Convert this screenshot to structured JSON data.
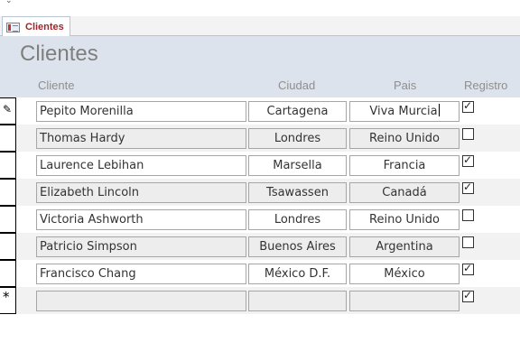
{
  "tab": {
    "label": "Clientes",
    "icon": "form-icon"
  },
  "form": {
    "title": "Clientes"
  },
  "columns": {
    "cliente": "Cliente",
    "ciudad": "Ciudad",
    "pais": "Pais",
    "registro": "Registro"
  },
  "records": [
    {
      "cliente": "Pepito Morenilla",
      "ciudad": "Cartagena",
      "pais": "Viva Murcia",
      "registro": true,
      "selector": "pencil"
    },
    {
      "cliente": "Thomas Hardy",
      "ciudad": "Londres",
      "pais": "Reino Unido",
      "registro": false,
      "selector": ""
    },
    {
      "cliente": "Laurence Lebihan",
      "ciudad": "Marsella",
      "pais": "Francia",
      "registro": true,
      "selector": ""
    },
    {
      "cliente": "Elizabeth Lincoln",
      "ciudad": "Tsawassen",
      "pais": "Canadá",
      "registro": true,
      "selector": ""
    },
    {
      "cliente": "Victoria Ashworth",
      "ciudad": "Londres",
      "pais": "Reino Unido",
      "registro": false,
      "selector": ""
    },
    {
      "cliente": "Patricio Simpson",
      "ciudad": "Buenos Aires",
      "pais": "Argentina",
      "registro": false,
      "selector": ""
    },
    {
      "cliente": "Francisco Chang",
      "ciudad": "México D.F.",
      "pais": "México",
      "registro": true,
      "selector": ""
    },
    {
      "cliente": "",
      "ciudad": "",
      "pais": "",
      "registro": true,
      "selector": "new-record"
    }
  ],
  "glyphs": {
    "pencil": "✎",
    "new-record": "*",
    "check": "✓"
  },
  "colors": {
    "header_band": "#dde3ec",
    "tab_label": "#a0262b",
    "alt_row": "#f2f2f2"
  }
}
